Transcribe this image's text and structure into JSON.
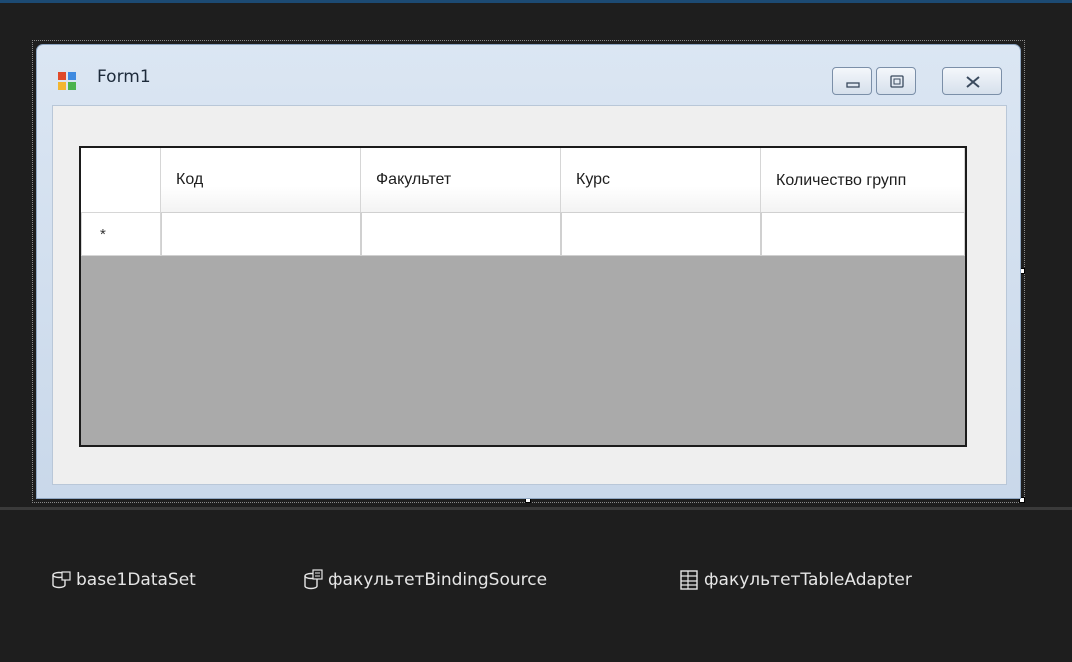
{
  "form": {
    "title": "Form1",
    "icons": {
      "app": "windows-form-icon",
      "minimize": "minimize-icon",
      "maximize": "maximize-icon",
      "close": "close-icon"
    }
  },
  "grid": {
    "row_marker": "*",
    "columns": [
      "Код",
      "Факультет",
      "Курс",
      "Количество групп"
    ],
    "rows": [
      [
        "",
        "",
        "",
        ""
      ]
    ]
  },
  "tray": {
    "items": [
      {
        "label": "base1DataSet",
        "icon": "dataset-icon"
      },
      {
        "label": "факультетBindingSource",
        "icon": "binding-source-icon"
      },
      {
        "label": "факультетTableAdapter",
        "icon": "table-adapter-icon"
      }
    ]
  },
  "colors": {
    "grid_background": "#aaaaaa",
    "designer_background": "#1e1e1e",
    "form_client": "#efefef"
  }
}
